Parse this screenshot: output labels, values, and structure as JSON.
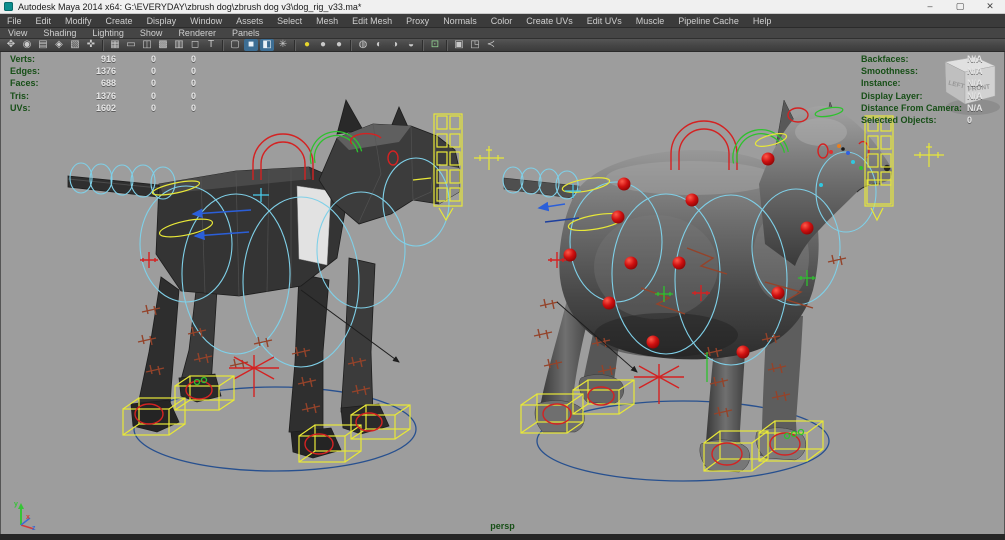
{
  "window": {
    "title": "Autodesk Maya 2014 x64: G:\\EVERYDAY\\zbrush dog\\zbrush dog v3\\dog_rig_v33.ma*",
    "controls": {
      "minimize": "–",
      "maximize": "▢",
      "close": "✕"
    }
  },
  "menubar": {
    "items": [
      "File",
      "Edit",
      "Modify",
      "Create",
      "Display",
      "Window",
      "Assets",
      "Select",
      "Mesh",
      "Edit Mesh",
      "Proxy",
      "Normals",
      "Color",
      "Create UVs",
      "Edit UVs",
      "Muscle",
      "Pipeline Cache",
      "Help"
    ]
  },
  "panel_menu": {
    "items": [
      "View",
      "Shading",
      "Lighting",
      "Show",
      "Renderer",
      "Panels"
    ]
  },
  "toolbar": {
    "icons": [
      {
        "name": "select-camera-icon",
        "glyph": "✥"
      },
      {
        "name": "lock-camera-icon",
        "glyph": "◉"
      },
      {
        "name": "camera-attributes-icon",
        "glyph": "▤"
      },
      {
        "name": "bookmark-icon",
        "glyph": "◈"
      },
      {
        "name": "image-plane-icon",
        "glyph": "▧"
      },
      {
        "name": "two-d-pan-zoom-icon",
        "glyph": "✜"
      },
      {
        "name": "grid-icon",
        "glyph": "▦"
      },
      {
        "name": "film-gate-icon",
        "glyph": "▭"
      },
      {
        "name": "resolution-gate-icon",
        "glyph": "◫"
      },
      {
        "name": "gate-mask-icon",
        "glyph": "▩"
      },
      {
        "name": "field-chart-icon",
        "glyph": "▥"
      },
      {
        "name": "safe-action-icon",
        "glyph": "◻"
      },
      {
        "name": "safe-title-icon",
        "glyph": "T"
      },
      {
        "name": "wireframe-icon",
        "glyph": "▢"
      },
      {
        "name": "smooth-shade-icon",
        "glyph": "■"
      },
      {
        "name": "textured-icon",
        "glyph": "◧"
      },
      {
        "name": "use-all-lights-icon",
        "glyph": "✳"
      },
      {
        "name": "default-lighting-icon",
        "glyph": "●"
      },
      {
        "name": "all-lights-icon",
        "glyph": "●"
      },
      {
        "name": "flat-lighting-icon",
        "glyph": "●"
      },
      {
        "name": "shadows-icon",
        "glyph": "◍"
      },
      {
        "name": "ambient-occlusion-icon",
        "glyph": "◐"
      },
      {
        "name": "motion-blur-icon",
        "glyph": "◑"
      },
      {
        "name": "multisample-icon",
        "glyph": "◒"
      },
      {
        "name": "isolate-select-icon",
        "glyph": "⊡"
      },
      {
        "name": "xray-icon",
        "glyph": "▣"
      },
      {
        "name": "exposure-icon",
        "glyph": "◳"
      },
      {
        "name": "share-icon",
        "glyph": "≺"
      }
    ]
  },
  "hud_left": {
    "rows": [
      {
        "label": "Verts:",
        "v1": "916",
        "v2": "0",
        "v3": "0"
      },
      {
        "label": "Edges:",
        "v1": "1376",
        "v2": "0",
        "v3": "0"
      },
      {
        "label": "Faces:",
        "v1": "688",
        "v2": "0",
        "v3": "0"
      },
      {
        "label": "Tris:",
        "v1": "1376",
        "v2": "0",
        "v3": "0"
      },
      {
        "label": "UVs:",
        "v1": "1602",
        "v2": "0",
        "v3": "0"
      }
    ]
  },
  "hud_right": {
    "rows": [
      {
        "label": "Backfaces:",
        "value": "N/A"
      },
      {
        "label": "Smoothness:",
        "value": "N/A"
      },
      {
        "label": "Instance:",
        "value": "N/A"
      },
      {
        "label": "Display Layer:",
        "value": "N/A"
      },
      {
        "label": "Distance From Camera:",
        "value": "N/A"
      },
      {
        "label": "Selected Objects:",
        "value": "0"
      }
    ]
  },
  "viewport": {
    "camera_label": "persp",
    "cube": {
      "left": "LEFT",
      "front": "FRONT"
    },
    "axis": {
      "x": "x",
      "y": "y",
      "z": "z"
    }
  },
  "colors": {
    "viewport_bg": "#9d9d9d",
    "hud_label_green": "#174f17",
    "rig_cyan": "#7fd0e8",
    "rig_yellow": "#e8e838",
    "rig_red": "#d42222",
    "rig_green": "#2ec22e",
    "rig_brown": "#94432a",
    "ground_blue": "#27508f",
    "active_icon_blue": "#3d6e94"
  }
}
